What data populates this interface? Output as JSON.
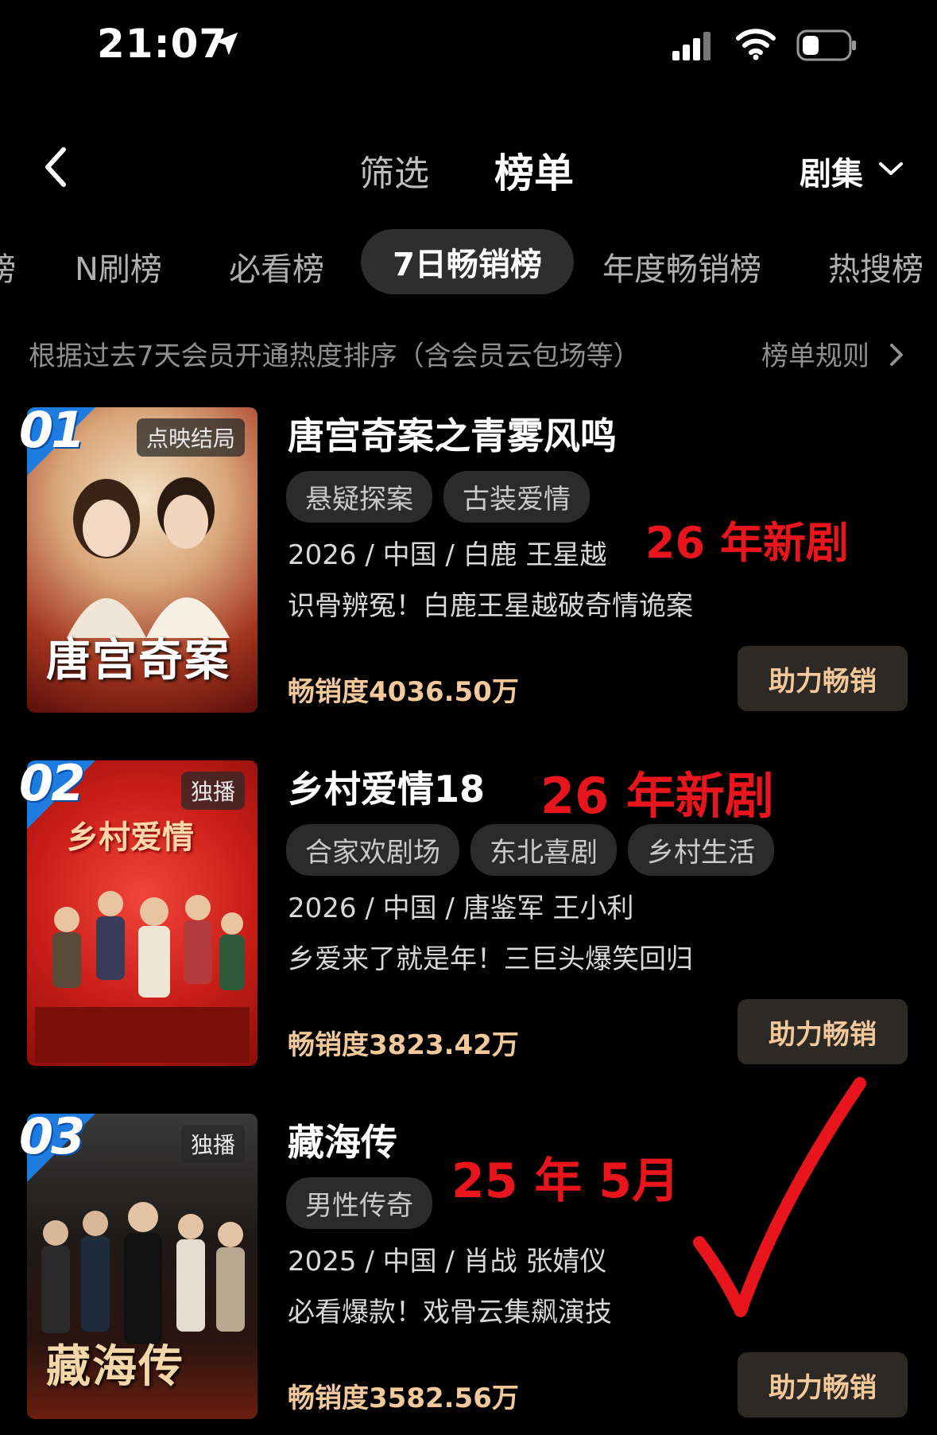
{
  "status_bar": {
    "time": "21:07"
  },
  "nav": {
    "filter_label": "筛选",
    "rank_label": "榜单",
    "category_label": "剧集"
  },
  "tabs": [
    {
      "label": "榜"
    },
    {
      "label": "N刷榜"
    },
    {
      "label": "必看榜"
    },
    {
      "label": "7日畅销榜",
      "active": true
    },
    {
      "label": "年度畅销榜"
    },
    {
      "label": "热搜榜"
    }
  ],
  "subheader": {
    "description": "根据过去7天会员开通热度排序（含会员云包场等）",
    "rules_link": "榜单规则"
  },
  "items": [
    {
      "rank": "01",
      "badge": "点映结局",
      "poster_text": "唐宫奇案",
      "title": "唐宫奇案之青雾风鸣",
      "tags": [
        "悬疑探案",
        "古装爱情"
      ],
      "meta": "2026 / 中国 / 白鹿 王星越",
      "description": "识骨辨冤！白鹿王星越破奇情诡案",
      "sales": "畅销度4036.50万",
      "button": "助力畅销",
      "annotation": "26 年新剧"
    },
    {
      "rank": "02",
      "badge": "独播",
      "poster_text": "乡村爱情",
      "title": "乡村爱情18",
      "tags": [
        "合家欢剧场",
        "东北喜剧",
        "乡村生活"
      ],
      "meta": "2026 / 中国 / 唐鉴军 王小利",
      "description": "乡爱来了就是年！三巨头爆笑回归",
      "sales": "畅销度3823.42万",
      "button": "助力畅销",
      "annotation": "26 年新剧"
    },
    {
      "rank": "03",
      "badge": "独播",
      "poster_text": "藏海传",
      "title": "藏海传",
      "tags": [
        "男性传奇"
      ],
      "meta": "2025 / 中国 / 肖战 张婧仪",
      "description": "必看爆款！戏骨云集飙演技",
      "sales": "畅销度3582.56万",
      "button": "助力畅销",
      "annotation": "25 年 5月"
    }
  ],
  "colors": {
    "background": "#000000",
    "accent_gold": "#f3c89a",
    "annotation_red": "#e8161c",
    "rank_blue": "#1e7be0",
    "tab_active_bg": "#2e2e2e"
  }
}
